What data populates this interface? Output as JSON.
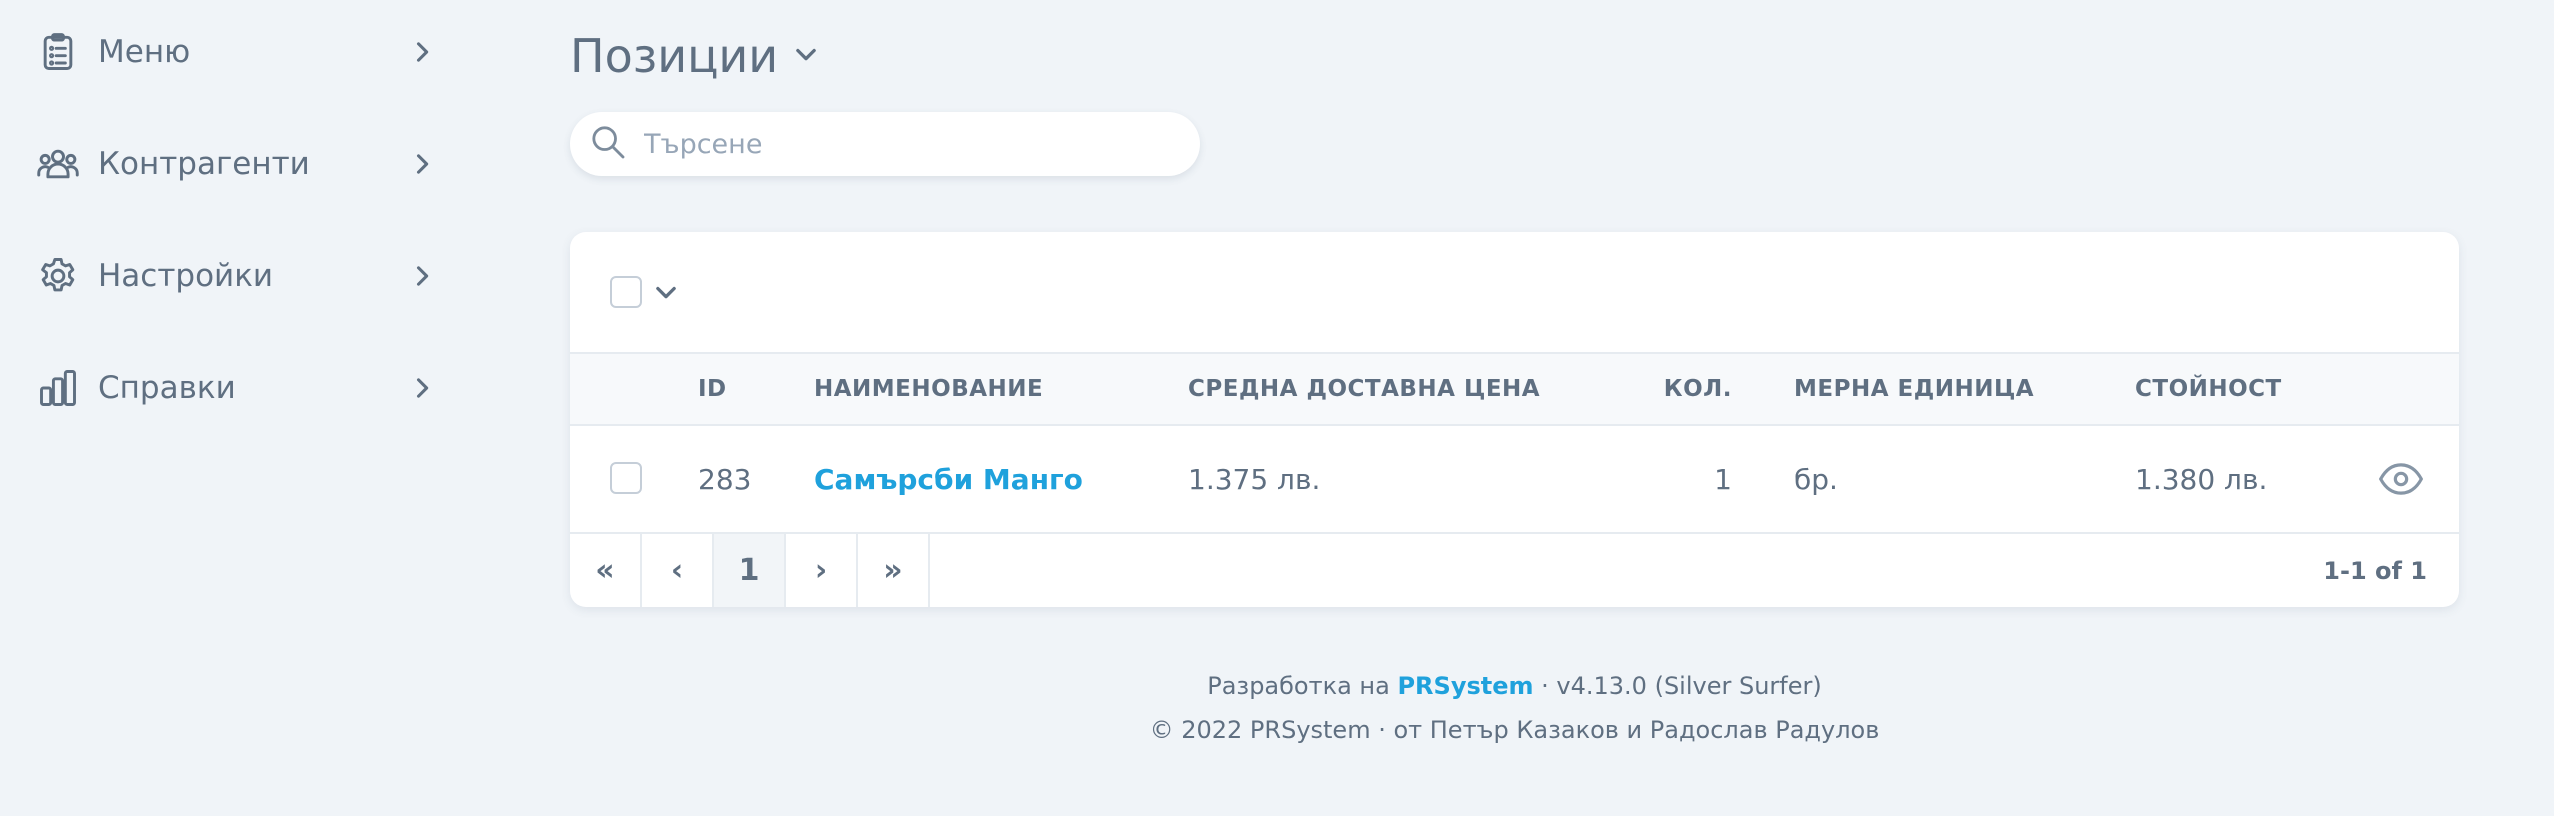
{
  "sidebar": {
    "items": [
      {
        "label": "Меню",
        "icon": "clipboard-list-icon"
      },
      {
        "label": "Контрагенти",
        "icon": "users-icon"
      },
      {
        "label": "Настройки",
        "icon": "gear-icon"
      },
      {
        "label": "Справки",
        "icon": "bar-chart-icon"
      }
    ]
  },
  "header": {
    "title": "Позиции"
  },
  "search": {
    "placeholder": "Търсене",
    "value": ""
  },
  "table": {
    "columns": [
      "ID",
      "НАИМЕНОВАНИЕ",
      "СРЕДНА ДОСТАВНА ЦЕНА",
      "КОЛ.",
      "МЕРНА ЕДИНИЦА",
      "СТОЙНОСТ"
    ],
    "rows": [
      {
        "id": "283",
        "name": "Самърсби Манго",
        "avg_price": "1.375 лв.",
        "qty": "1",
        "unit": "бр.",
        "value": "1.380 лв."
      }
    ]
  },
  "pagination": {
    "first": "«",
    "prev": "‹",
    "current": "1",
    "next": "›",
    "last": "»",
    "info": "1-1 of 1"
  },
  "footer": {
    "line1_prefix": "Разработка на",
    "brand": "PRSystem",
    "line1_suffix": "· v4.13.0 (Silver Surfer)",
    "line2": "© 2022 PRSystem · от Петър Казаков и Радослав Радулов"
  },
  "colors": {
    "background": "#f0f4f8",
    "text": "#5f6f81",
    "accent": "#1fa1dc"
  }
}
